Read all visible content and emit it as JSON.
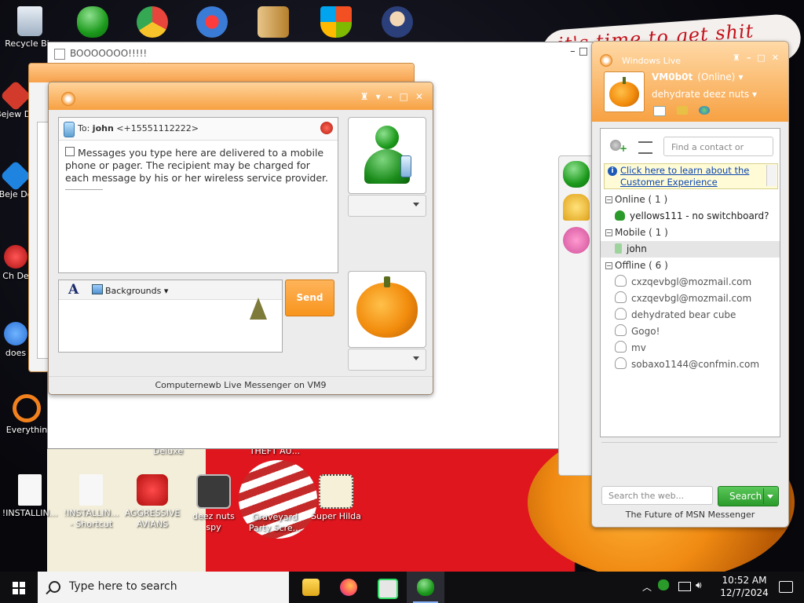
{
  "desktop": {
    "wallpaper_text": "it's time to get shit",
    "icons": [
      {
        "name": "recycle-bin-icon",
        "label": "Recycle Bin",
        "color": "#cfd8e3"
      },
      {
        "name": "messenger-app-icon",
        "label": "",
        "color": "#2aa02a"
      },
      {
        "name": "chrome-icon",
        "label": "",
        "color": "#e8453c"
      },
      {
        "name": "paint-icon",
        "label": "",
        "color": "#3a7bd5"
      },
      {
        "name": "winrar-icon",
        "label": "",
        "color": "#b57f2b"
      },
      {
        "name": "shield-icon",
        "label": "",
        "color": "#3b8ee0"
      },
      {
        "name": "game-icon",
        "label": "",
        "color": "#4c6bb0"
      },
      {
        "name": "bejeweled-icon-1",
        "label": "Bejew De",
        "color": "#d23b2b"
      },
      {
        "name": "bejeweled-icon-2",
        "label": "Beje De",
        "color": "#1f83e0"
      },
      {
        "name": "chuzzle-icon",
        "label": "Ch De",
        "color": "#cc2222"
      },
      {
        "name": "does-icon",
        "label": "does",
        "color": "#2a6fd6"
      },
      {
        "name": "everything-icon",
        "label": "Everythin",
        "color": "#f2811d"
      },
      {
        "name": "installing-doc-icon",
        "label": "!INSTALLIN...",
        "color": "#f1f1f1"
      },
      {
        "name": "installing-shortcut-icon",
        "label": "!INSTALLIN... - Shortcut",
        "color": "#f1f1f1"
      },
      {
        "name": "angry-birds-icon",
        "label": "AGGRESSIVE AVIANS",
        "color": "#d62020"
      },
      {
        "name": "deez-nuts-spy-icon",
        "label": "deez nuts spy",
        "color": "#555555"
      },
      {
        "name": "graveyard-icon",
        "label": "Graveyard Party Scre...",
        "color": "#6a6a6a"
      },
      {
        "name": "super-hilda-icon",
        "label": "Super Hilda",
        "color": "#d9c08a"
      },
      {
        "name": "deluxe-label",
        "label": "Deluxe",
        "color": ""
      },
      {
        "name": "theft-label",
        "label": "THEFT AU...",
        "color": ""
      }
    ]
  },
  "behind_window": {
    "title": "BOOOOOOO!!!!!",
    "controls": "–    □"
  },
  "conversation": {
    "to_prefix": "To:",
    "to_name": "john",
    "to_number": "<+15551112222>",
    "notice": "Messages you type here are delivered to a mobile phone or pager. The recipient may be charged for each message by his or her wireless service provider.",
    "font_button": "A",
    "backgrounds_label": "Backgrounds",
    "send_label": "Send",
    "status_bar": "Computernewb Live Messenger on VM9",
    "controls": [
      "▾",
      "–",
      "□",
      "✕"
    ]
  },
  "contact_list": {
    "brand": "Windows Live",
    "controls": [
      "–",
      "□",
      "✕"
    ],
    "my_name": "VM0b0t",
    "my_status": "(Online)",
    "my_message": "dehydrate deez nuts",
    "find_placeholder": "Find a contact or number...",
    "info_link": "Click here to learn about the Customer Experience",
    "groups": [
      {
        "label": "Online ( 1 )",
        "contacts": [
          {
            "name": "yellows111 - no switchboard?",
            "state": "online"
          }
        ]
      },
      {
        "label": "Mobile ( 1 )",
        "contacts": [
          {
            "name": "john",
            "state": "mobile"
          }
        ]
      },
      {
        "label": "Offline ( 6 )",
        "contacts": [
          {
            "name": "cxzqevbgl@mozmail.com",
            "state": "offline"
          },
          {
            "name": "cxzqevbgl@mozmail.com",
            "state": "offline"
          },
          {
            "name": "dehydrated bear cube",
            "state": "offline"
          },
          {
            "name": "Gogo!",
            "state": "offline"
          },
          {
            "name": "mv",
            "state": "offline"
          },
          {
            "name": "sobaxo1144@confmin.com",
            "state": "offline"
          }
        ]
      }
    ],
    "web_search_placeholder": "Search the web...",
    "search_button": "Search",
    "footer": "The Future of MSN Messenger"
  },
  "taskbar": {
    "search_placeholder": "Type here to search",
    "apps": [
      {
        "name": "file-explorer-icon",
        "color": "#f2c12e"
      },
      {
        "name": "firefox-icon",
        "color": "#ff7139"
      },
      {
        "name": "window-app-icon",
        "color": "#dcdcdc"
      },
      {
        "name": "messenger-taskbar-icon",
        "color": "#2aa02a"
      }
    ],
    "time": "10:52 AM",
    "date": "12/7/2024"
  },
  "colors": {
    "accent_orange": "#f7a142",
    "online_green": "#2a9b2a",
    "link_blue": "#0c46b0"
  }
}
